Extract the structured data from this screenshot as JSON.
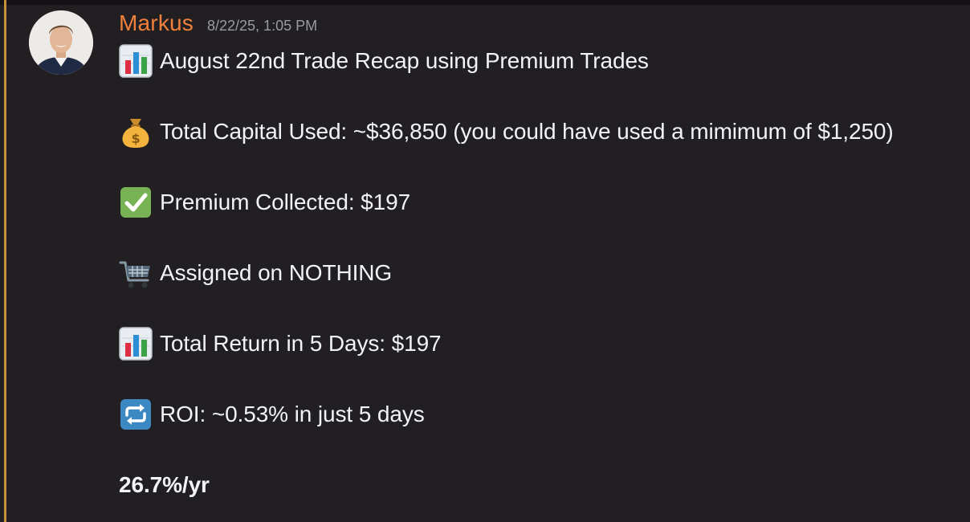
{
  "message": {
    "author": "Markus",
    "timestamp": "8/22/25, 1:05 PM",
    "lines": [
      {
        "icon": "bar-chart-icon",
        "text": "August 22nd Trade Recap using Premium Trades"
      },
      {
        "icon": "money-bag-icon",
        "text": "Total Capital Used: ~$36,850 (you could have used a mimimum of $1,250)"
      },
      {
        "icon": "check-mark-icon",
        "text": "Premium Collected: $197"
      },
      {
        "icon": "shopping-cart-icon",
        "text": "Assigned on NOTHING"
      },
      {
        "icon": "bar-chart-icon",
        "text": "Total Return in 5 Days: $197"
      },
      {
        "icon": "repeat-icon",
        "text": "ROI: ~0.53% in just 5 days"
      }
    ],
    "summary": "26.7%/yr"
  },
  "colors": {
    "background": "#221f22",
    "username": "#f0813c",
    "timestamp": "#9a9ba1",
    "text": "#f2f3f5",
    "highlight_bar": "#c8903a"
  }
}
